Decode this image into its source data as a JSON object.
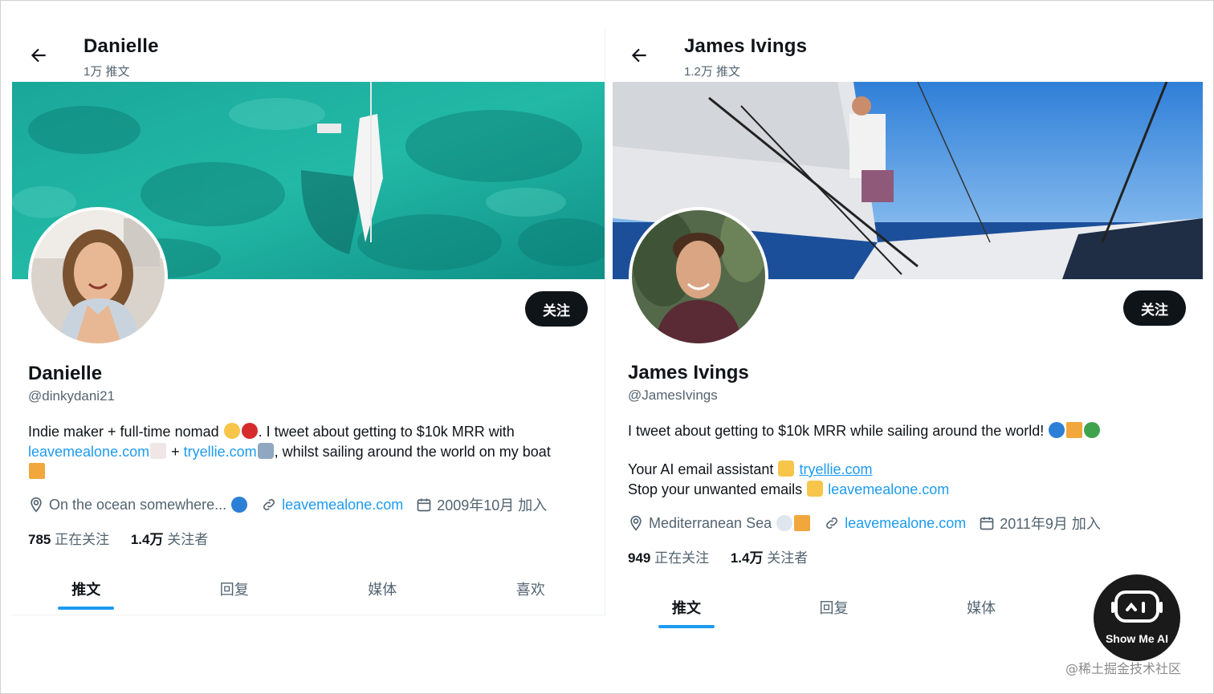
{
  "profiles": [
    {
      "topbar_name": "Danielle",
      "topbar_count": "1万 推文",
      "follow_label": "关注",
      "name": "Danielle",
      "handle": "@dinkydani21",
      "bio_p1": "Indie maker + full-time nomad",
      "bio_p2": ". I tweet about getting to $10k MRR with",
      "bio_link1": "leavemealone.com",
      "bio_p3": " + ",
      "bio_link2": "tryellie.com",
      "bio_p4": ", whilst sailing around the world on my boat",
      "location": "On the ocean somewhere...",
      "website": "leavemealone.com",
      "joined": "2009年10月 加入",
      "following_count": "785",
      "following_label": "正在关注",
      "followers_count": "1.4万",
      "followers_label": "关注者",
      "tabs": [
        "推文",
        "回复",
        "媒体",
        "喜欢"
      ]
    },
    {
      "topbar_name": "James Ivings",
      "topbar_count": "1.2万 推文",
      "follow_label": "关注",
      "name": "James Ivings",
      "handle": "@JamesIvings",
      "bio_line1": "I tweet about getting to $10k MRR while sailing around the world!",
      "bio_line2_text": "Your AI email assistant",
      "bio_line2_link": "tryellie.com",
      "bio_line3_text": "Stop your unwanted emails",
      "bio_line3_link": "leavemealone.com",
      "location": "Mediterranean Sea",
      "website": "leavemealone.com",
      "joined": "2011年9月 加入",
      "following_count": "949",
      "following_label": "正在关注",
      "followers_count": "1.4万",
      "followers_label": "关注者",
      "tabs": [
        "推文",
        "回复",
        "媒体"
      ]
    }
  ],
  "badge": {
    "text": "Show Me AI"
  },
  "watermark": "@稀土掘金技术社区",
  "colors": {
    "accent": "#1d9bf0",
    "text": "#0f1419",
    "muted": "#536471"
  },
  "icons": [
    "back-arrow-icon",
    "location-pin-icon",
    "link-icon",
    "calendar-icon",
    "robot-icon"
  ]
}
